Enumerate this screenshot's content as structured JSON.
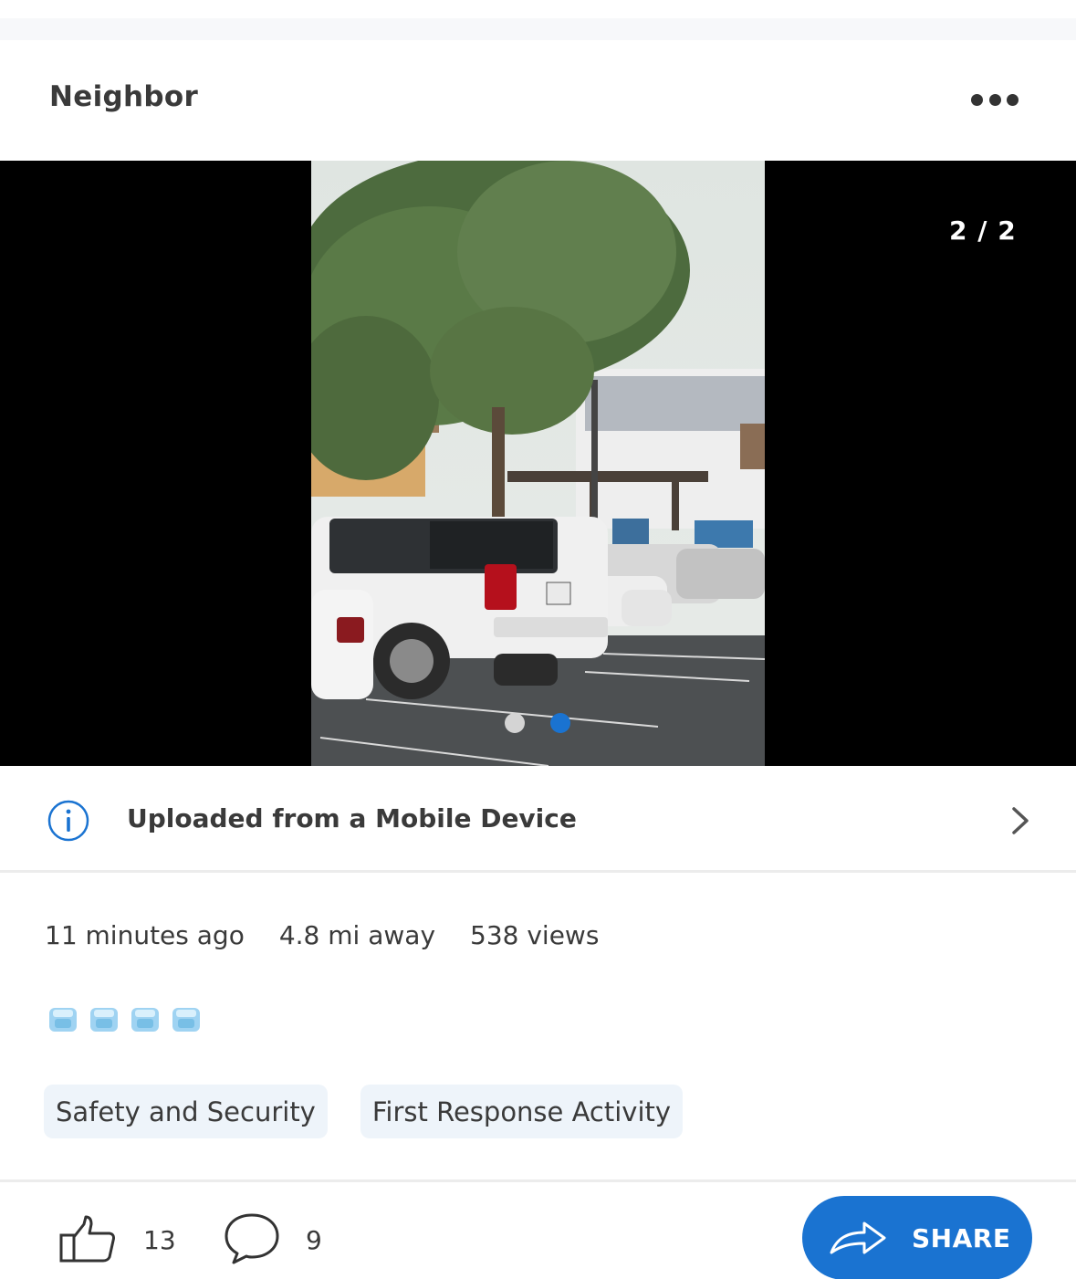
{
  "header": {
    "title": "Neighbor",
    "more_icon": "more-horizontal-icon"
  },
  "media": {
    "counter": "2 / 2",
    "photo_alt": "Parking lot with white SUV and cars",
    "page_count": 2,
    "active_page": 2
  },
  "info": {
    "text": "Uploaded from a Mobile Device",
    "icon": "info-icon"
  },
  "meta": {
    "time": "11 minutes ago",
    "distance": "4.8 mi away",
    "views": "538 views"
  },
  "emojis": [
    "ice-cube",
    "ice-cube",
    "ice-cube",
    "ice-cube"
  ],
  "tags": [
    "Safety and Security",
    "First Response Activity"
  ],
  "footer": {
    "likes": "13",
    "comments": "9",
    "share_label": "SHARE"
  },
  "colors": {
    "accent": "#1a73d1",
    "tag_bg": "#eef4fa",
    "divider": "#ececec"
  }
}
